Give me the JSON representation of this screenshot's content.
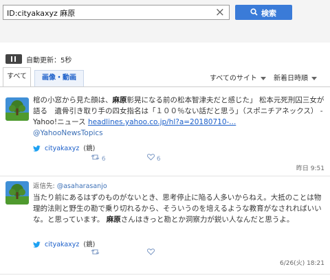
{
  "search": {
    "query": "ID:cityakaxyz 麻原",
    "button_label": "検索"
  },
  "auto_update": {
    "label": "自動更新：5秒"
  },
  "tabs": {
    "all": "すべて",
    "media": "画像・動画"
  },
  "sort": {
    "site": "すべてのサイト",
    "order": "新着日時順"
  },
  "tweets": [
    {
      "text_1": "棺の小窓から見た顔は、",
      "bold_1": "麻原",
      "text_2": "彰晃になる前の松本智津夫だと感じた」 松本元死刑囚三女が語る　遺骨引き取り手の四女指名は「１００％ない話だと思う」（スポニチアネックス） - Yahoo!ニュース ",
      "link": "headlines.yahoo.co.jp/hl?a=20180710-...",
      "mention": "@YahooNewsTopics",
      "via_user": "cityakaxyz",
      "via_name": "(鏡)",
      "retweets": "6",
      "likes": "6",
      "time": "昨日 9:51"
    },
    {
      "reply_label": "返信先:",
      "reply_to": "@asaharasanjo",
      "text_1": "当たり前にあるはずのものがないとき、思考停止に陥る人多いからねえ。大抵のことは物理的法則と野生の勘で乗り切れるから、そういうのを培えるような教育がなされればいいな。と思っています。 ",
      "bold_1": "麻原",
      "text_2": "さんはきっと勘とか洞察力が鋭い人なんだと思うよ。",
      "via_user": "cityakaxyz",
      "via_name": "(鏡)",
      "time": "6/26(火) 18:21"
    }
  ],
  "colors": {
    "search_button": "#3a7bd8",
    "link": "#1a5ec9",
    "twitter": "#1da1f2"
  }
}
